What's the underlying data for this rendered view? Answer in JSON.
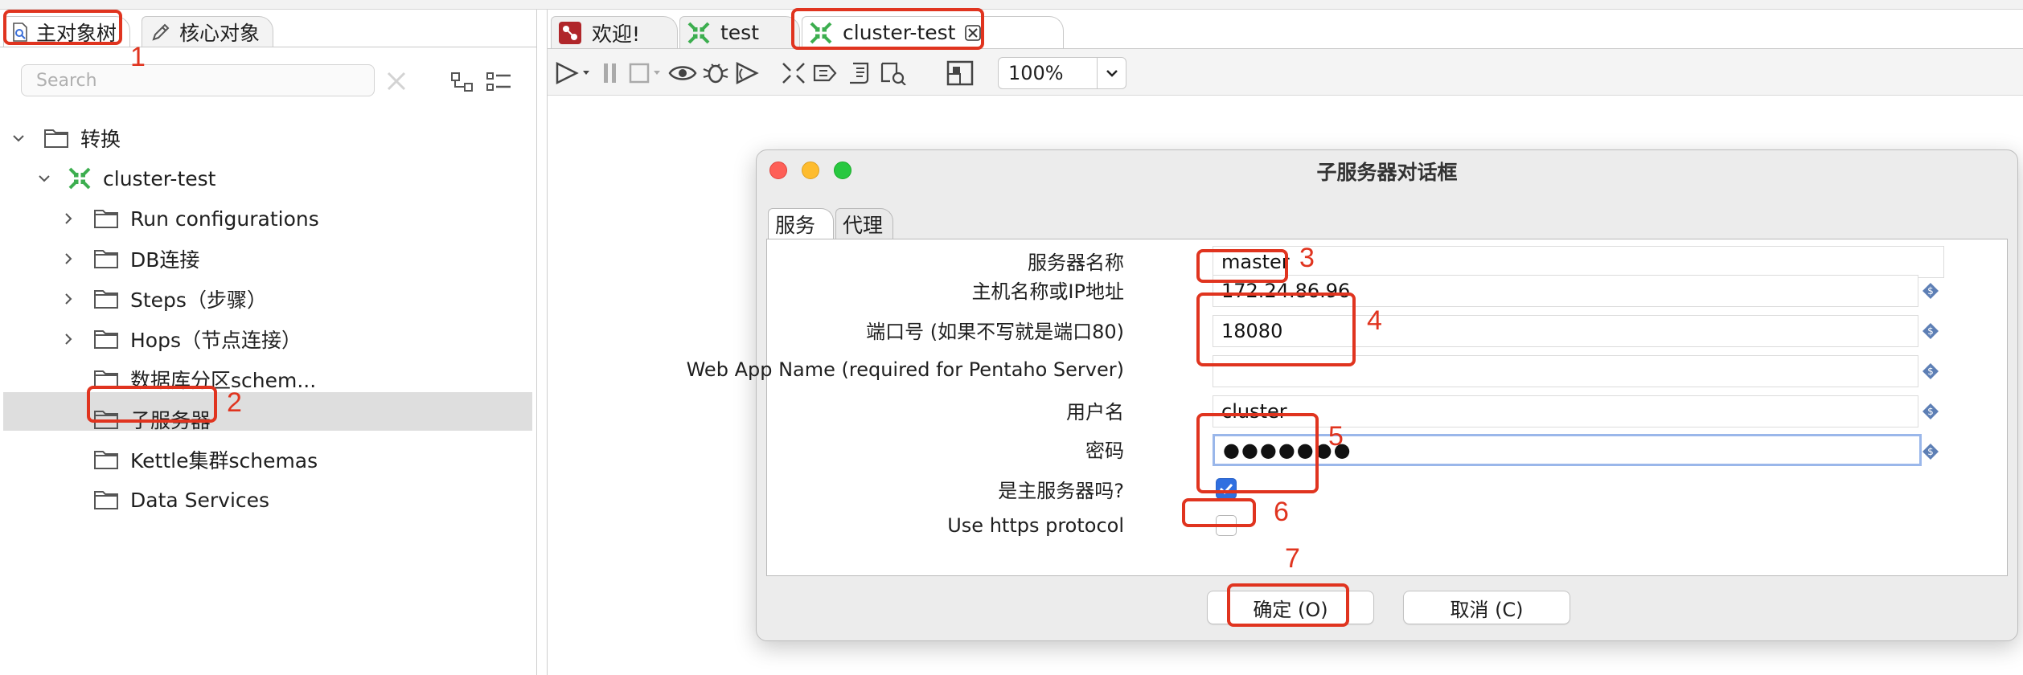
{
  "left_panel": {
    "tabs": [
      {
        "label": "主对象树",
        "icon": "explore-icon"
      },
      {
        "label": "核心对象",
        "icon": "pencil-icon"
      }
    ],
    "search_placeholder": "Search",
    "tree": [
      {
        "label": "转换",
        "expanded": true,
        "level": 0
      },
      {
        "label": "cluster-test",
        "expanded": true,
        "level": 1,
        "icon": "transformation-icon"
      },
      {
        "label": "Run configurations",
        "level": 2
      },
      {
        "label": "DB连接",
        "level": 2
      },
      {
        "label": "Steps（步骤）",
        "level": 2
      },
      {
        "label": "Hops（节点连接）",
        "level": 2
      },
      {
        "label": "数据库分区schem...",
        "level": 2
      },
      {
        "label": "子服务器",
        "level": 2,
        "selected": true
      },
      {
        "label": "Kettle集群schemas",
        "level": 2
      },
      {
        "label": "Data Services",
        "level": 2
      }
    ]
  },
  "editor_tabs": [
    {
      "label": "欢迎!",
      "icon": "welcome-icon"
    },
    {
      "label": "test",
      "icon": "transformation-icon"
    },
    {
      "label": "cluster-test",
      "icon": "transformation-icon",
      "active": true
    }
  ],
  "toolbar": {
    "zoom": "100%"
  },
  "dialog": {
    "title": "子服务器对话框",
    "tabs": [
      "服务",
      "代理"
    ],
    "fields": {
      "server_name": {
        "label": "服务器名称",
        "value": "master"
      },
      "hostname": {
        "label": "主机名称或IP地址",
        "value": "172.24.86.96"
      },
      "port": {
        "label": "端口号 (如果不写就是端口80)",
        "value": "18080"
      },
      "webapp": {
        "label": "Web App Name (required for Pentaho Server)",
        "value": ""
      },
      "username": {
        "label": "用户名",
        "value": "cluster"
      },
      "password": {
        "label": "密码",
        "value": "●●●●●●●"
      },
      "is_master": {
        "label": "是主服务器吗?",
        "checked": true
      },
      "https": {
        "label": "Use https protocol",
        "checked": false
      }
    },
    "buttons": {
      "ok": "确定 (O)",
      "cancel": "取消 (C)"
    }
  },
  "annotations": [
    "1",
    "2",
    "3",
    "4",
    "5",
    "6",
    "7"
  ],
  "colors": {
    "annotation": "#e0341f",
    "checkbox": "#2f6fe0",
    "transformation_icon": "#3cae4f"
  }
}
